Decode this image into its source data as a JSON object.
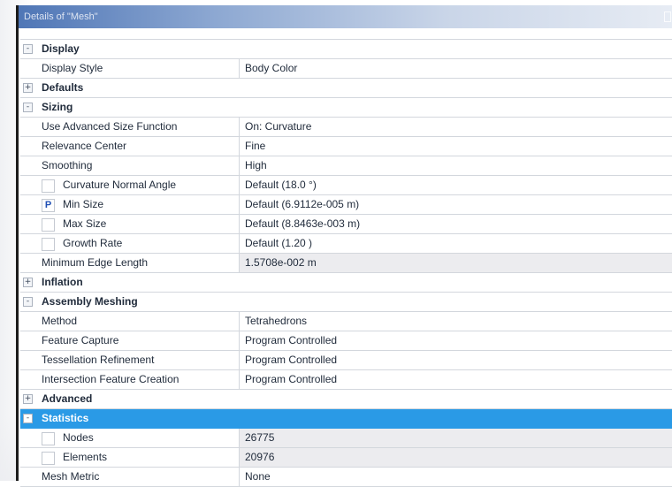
{
  "window": {
    "title": "Details of \"Mesh\""
  },
  "categories": {
    "display": {
      "label": "Display",
      "state": "-"
    },
    "defaults": {
      "label": "Defaults",
      "state": "+"
    },
    "sizing": {
      "label": "Sizing",
      "state": "-"
    },
    "inflation": {
      "label": "Inflation",
      "state": "+"
    },
    "assembly": {
      "label": "Assembly Meshing",
      "state": "-"
    },
    "advanced": {
      "label": "Advanced",
      "state": "+"
    },
    "statistics": {
      "label": "Statistics",
      "state": "-"
    }
  },
  "props": {
    "display_style": {
      "name": "Display Style",
      "value": "Body Color"
    },
    "use_adv_size": {
      "name": "Use Advanced Size Function",
      "value": "On: Curvature"
    },
    "relevance_center": {
      "name": "Relevance Center",
      "value": "Fine"
    },
    "smoothing": {
      "name": "Smoothing",
      "value": "High"
    },
    "curvature_angle": {
      "name": "Curvature Normal Angle",
      "value": "Default (18.0 °)"
    },
    "min_size": {
      "name": "Min Size",
      "value": "Default (6.9112e-005 m)",
      "marker": "P"
    },
    "max_size": {
      "name": "Max Size",
      "value": "Default (8.8463e-003 m)"
    },
    "growth_rate": {
      "name": "Growth Rate",
      "value": "Default (1.20 )"
    },
    "min_edge": {
      "name": "Minimum Edge Length",
      "value": "1.5708e-002 m"
    },
    "method": {
      "name": "Method",
      "value": "Tetrahedrons"
    },
    "feature_capture": {
      "name": "Feature Capture",
      "value": "Program Controlled"
    },
    "tess_refinement": {
      "name": "Tessellation Refinement",
      "value": "Program Controlled"
    },
    "intersection": {
      "name": "Intersection Feature Creation",
      "value": "Program Controlled"
    },
    "nodes": {
      "name": "Nodes",
      "value": "26775"
    },
    "elements": {
      "name": "Elements",
      "value": "20976"
    },
    "mesh_metric": {
      "name": "Mesh Metric",
      "value": "None"
    }
  },
  "colors": {
    "selection": "#2a9ae6",
    "titlebar": "#4f76b6",
    "readonly_cell": "#ececef"
  }
}
